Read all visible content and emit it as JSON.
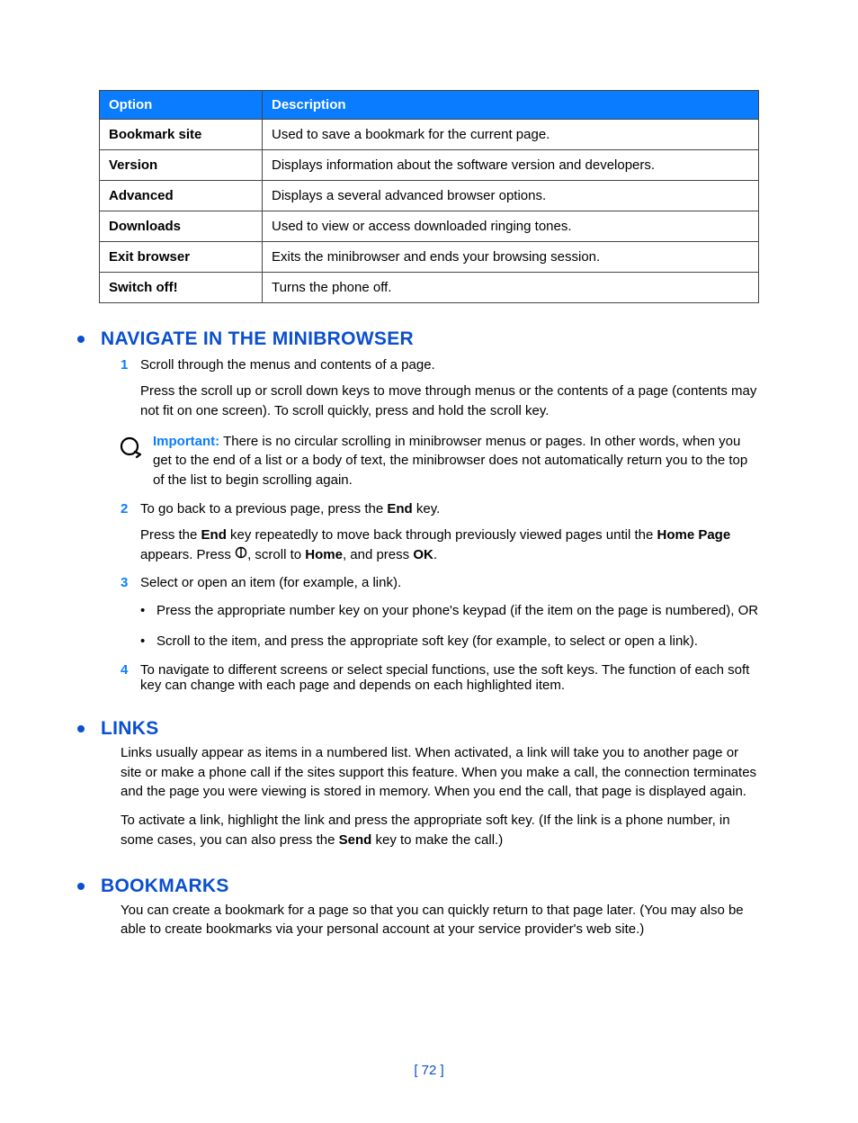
{
  "table": {
    "headers": [
      "Option",
      "Description"
    ],
    "rows": [
      {
        "option": "Bookmark site",
        "desc": "Used to save a bookmark for the current page."
      },
      {
        "option": "Version",
        "desc": "Displays information about the software version and developers."
      },
      {
        "option": "Advanced",
        "desc": "Displays a several advanced browser options."
      },
      {
        "option": "Downloads",
        "desc": "Used to view or access downloaded ringing tones."
      },
      {
        "option": "Exit browser",
        "desc": "Exits the minibrowser and ends your browsing session."
      },
      {
        "option": "Switch off!",
        "desc": "Turns the phone off."
      }
    ]
  },
  "sections": {
    "navigate": {
      "title": "Navigate in the minibrowser",
      "step1": {
        "num": "1",
        "text": "Scroll through the menus and contents of a page.",
        "detail": "Press the scroll up or scroll down keys to move through menus or the contents of a page (contents may not fit on one screen). To scroll quickly, press and hold the scroll key."
      },
      "important": {
        "label": "Important:",
        "text": " There is no circular scrolling in minibrowser menus or pages. In other words, when you get to the end of a list or a body of text, the minibrowser does not automatically return you to the top of the list to begin scrolling again."
      },
      "step2": {
        "num": "2",
        "pre": "To go back to a previous page, press the ",
        "end_key": "End",
        "post": " key.",
        "detail_pre": "Press the ",
        "detail_end": "End",
        "detail_mid": " key repeatedly to move back through previously viewed pages until the ",
        "home_page": "Home Page",
        "detail_mid2": " appears. Press ",
        "detail_mid3": ", scroll to ",
        "home": "Home",
        "detail_mid4": ", and press ",
        "ok": "OK",
        "detail_end2": "."
      },
      "step3": {
        "num": "3",
        "text": "Select or open an item (for example, a link)."
      },
      "bullets": [
        "Press the appropriate number key on your phone's keypad (if the item on the page is numbered), OR",
        "Scroll to the item, and press the appropriate soft key (for example, to select or open a link)."
      ],
      "step4": {
        "num": "4",
        "text": "To navigate to different screens or select special functions, use the soft keys. The function of each soft key can change with each page and depends on each highlighted item."
      }
    },
    "links": {
      "title": "Links",
      "p1": "Links usually appear as items in a numbered list. When activated, a link will take you to another page or site or make a phone call if the sites support this feature. When you make a call, the connection terminates and the page you were viewing is stored in memory. When you end the call, that page is displayed again.",
      "p2_pre": "To activate a link, highlight the link and press the appropriate soft key. (If the link is a phone number, in some cases, you can also press the ",
      "p2_send": "Send",
      "p2_post": " key to make the call.)"
    },
    "bookmarks": {
      "title": "Bookmarks",
      "p1": "You can create a bookmark for a page so that you can quickly return to that page later. (You may also be able to create bookmarks via your personal account at your service provider's web site.)"
    }
  },
  "footer": "[ 72 ]"
}
